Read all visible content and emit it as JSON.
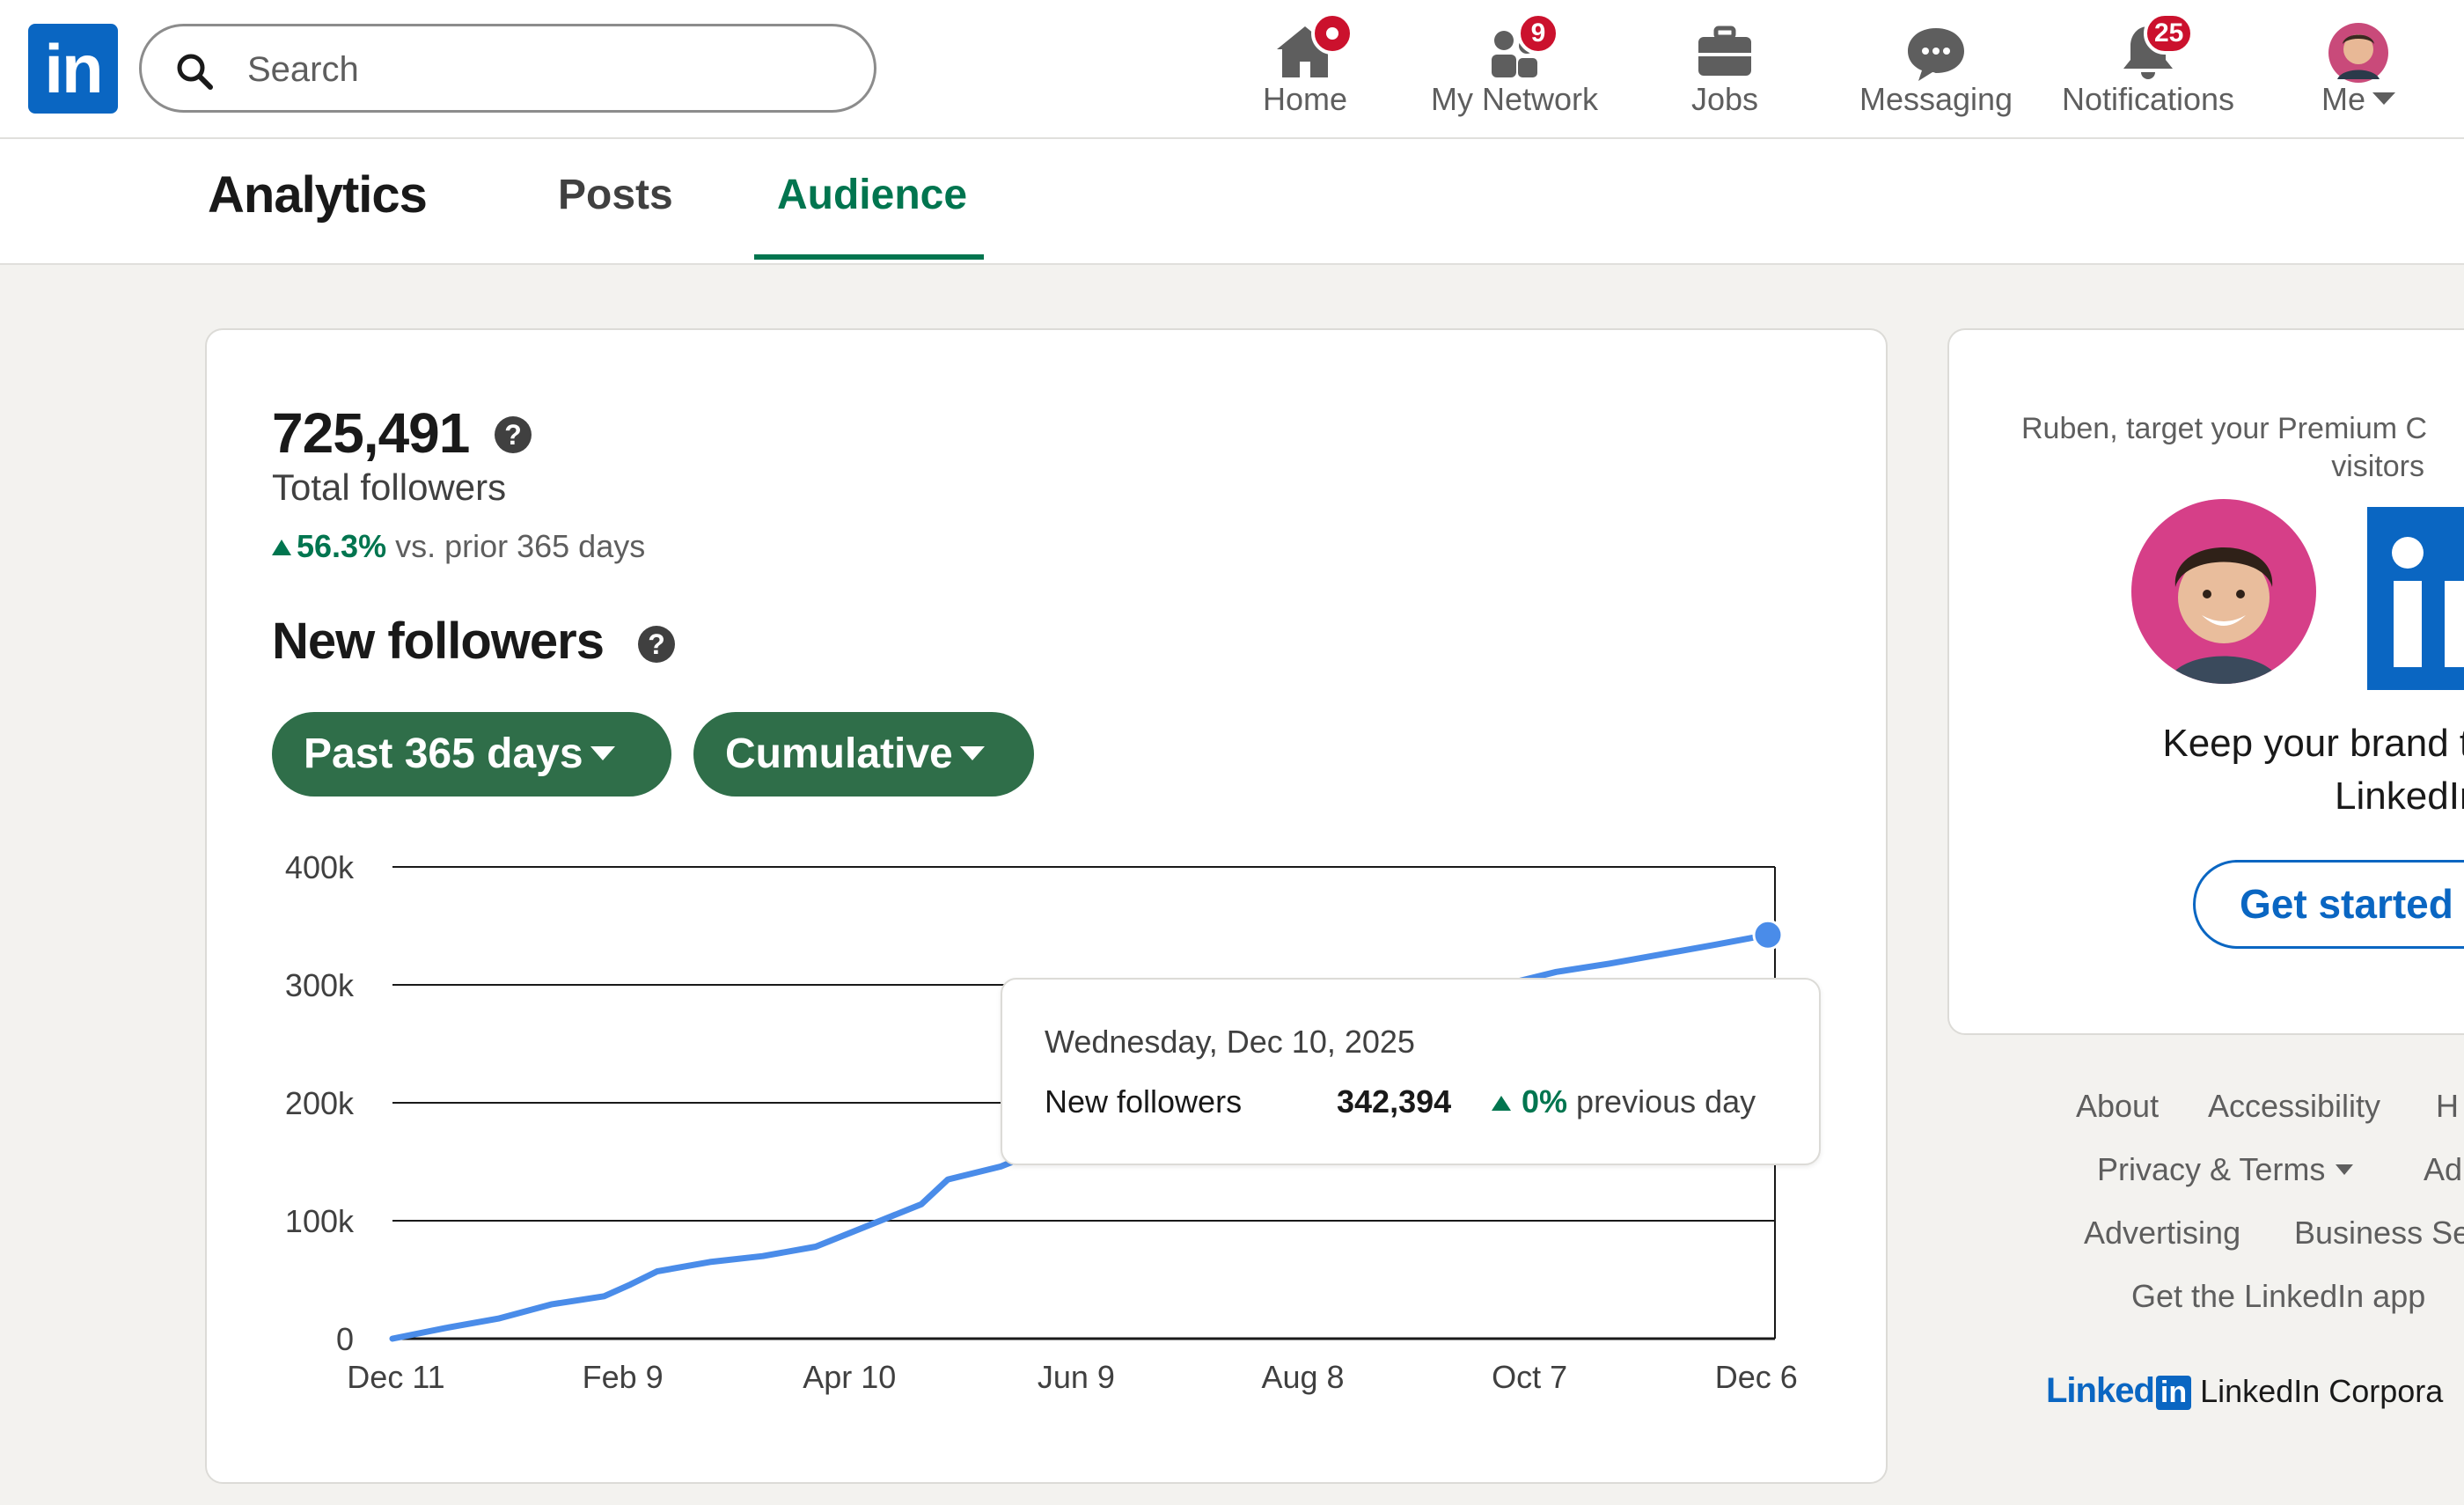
{
  "nav": {
    "logo_text": "in",
    "search_placeholder": "Search",
    "items": [
      {
        "label": "Home",
        "icon": "home-icon",
        "badge": ""
      },
      {
        "label": "My Network",
        "icon": "people-icon",
        "badge": "9"
      },
      {
        "label": "Jobs",
        "icon": "briefcase-icon",
        "badge": ""
      },
      {
        "label": "Messaging",
        "icon": "chat-icon",
        "badge": ""
      },
      {
        "label": "Notifications",
        "icon": "bell-icon",
        "badge": "25"
      },
      {
        "label": "Me",
        "icon": "avatar",
        "badge": ""
      }
    ]
  },
  "subnav": {
    "title": "Analytics",
    "tabs": [
      "Posts",
      "Audience"
    ],
    "active_tab": "Audience"
  },
  "summary": {
    "total": "725,491",
    "total_label": "Total followers",
    "change_pct": "56.3%",
    "change_text": "vs. prior 365 days"
  },
  "new_followers": {
    "heading": "New followers",
    "range_filter": "Past 365 days",
    "mode_filter": "Cumulative"
  },
  "chart_data": {
    "type": "line",
    "title": "",
    "xlabel": "",
    "ylabel": "",
    "x_ticks": [
      "Dec 11",
      "Feb 9",
      "Apr 10",
      "Jun 9",
      "Aug 8",
      "Oct 7",
      "Dec 6"
    ],
    "y_ticks": [
      "0",
      "100k",
      "200k",
      "300k",
      "400k"
    ],
    "ylim": [
      0,
      400000
    ],
    "grid": true,
    "series": [
      {
        "color": "#4a8ce9",
        "points": [
          [
            "2024-12-11",
            0
          ],
          [
            "2024-12-25",
            9000
          ],
          [
            "2025-01-08",
            17000
          ],
          [
            "2025-01-22",
            29000
          ],
          [
            "2025-02-05",
            36000
          ],
          [
            "2025-02-12",
            46000
          ],
          [
            "2025-02-19",
            57000
          ],
          [
            "2025-03-05",
            65000
          ],
          [
            "2025-03-19",
            70000
          ],
          [
            "2025-04-02",
            78000
          ],
          [
            "2025-04-16",
            96000
          ],
          [
            "2025-04-30",
            114000
          ],
          [
            "2025-05-07",
            135000
          ],
          [
            "2025-05-21",
            146000
          ],
          [
            "2025-06-04",
            164000
          ],
          [
            "2025-06-11",
            172000
          ],
          [
            "2025-06-25",
            188000
          ],
          [
            "2025-07-09",
            205000
          ],
          [
            "2025-07-23",
            222000
          ],
          [
            "2025-08-06",
            240000
          ],
          [
            "2025-08-20",
            257000
          ],
          [
            "2025-09-03",
            272000
          ],
          [
            "2025-09-17",
            287000
          ],
          [
            "2025-10-01",
            300000
          ],
          [
            "2025-10-15",
            311000
          ],
          [
            "2025-10-29",
            318000
          ],
          [
            "2025-11-12",
            326000
          ],
          [
            "2025-11-26",
            334000
          ],
          [
            "2025-12-10",
            342394
          ]
        ]
      }
    ],
    "highlight": {
      "date": "2025-12-10",
      "value": 342394
    }
  },
  "tooltip": {
    "date": "Wednesday, Dec 10, 2025",
    "label": "New followers",
    "value": "342,394",
    "change_pct": "0%",
    "change_text": "previous day"
  },
  "ad": {
    "headline": "Ruben, target your Premium C",
    "headline2": "visitors",
    "body_line1": "Keep your brand top of",
    "body_line2": "LinkedIn Ads",
    "cta": "Get started",
    "logo_text": "in"
  },
  "footer": {
    "links": [
      "About",
      "Accessibility",
      "H",
      "Privacy & Terms",
      "Ad",
      "Advertising",
      "Business Se",
      "Get the LinkedIn app"
    ],
    "brand": "Linked",
    "brand_box": "in",
    "corp": "LinkedIn Corpora"
  },
  "colors": {
    "brand_blue": "#0a66c2",
    "accent_green": "#01754f",
    "pill_green": "#2f6e49",
    "line_blue": "#4a8ce9",
    "badge_red": "#cb112d"
  }
}
